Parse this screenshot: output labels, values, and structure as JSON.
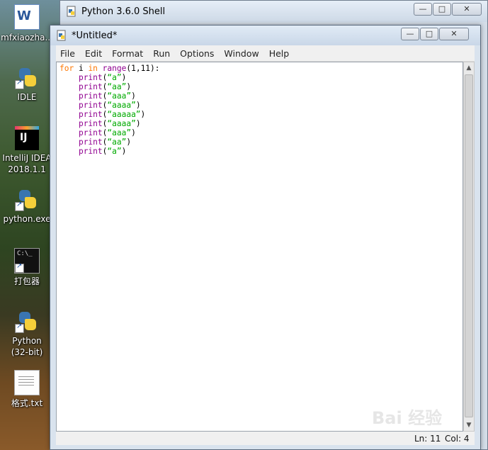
{
  "desktop": {
    "icons": [
      {
        "label": "mfxiaozha...",
        "icon": "word-document-icon"
      },
      {
        "label": "IDLE",
        "icon": "python-idle-icon"
      },
      {
        "label": "IntelliJ IDEA\n2018.1.1",
        "icon": "intellij-idea-icon"
      },
      {
        "label": "python.exe",
        "icon": "python-exe-icon"
      },
      {
        "label": "打包器",
        "icon": "command-prompt-icon"
      },
      {
        "label": "Python\n(32-bit)",
        "icon": "python-32bit-icon"
      },
      {
        "label": "格式.txt",
        "icon": "text-file-icon"
      }
    ]
  },
  "shell_window": {
    "title": "Python 3.6.0 Shell",
    "minimize": "—",
    "maximize": "□",
    "close": "✕"
  },
  "editor_window": {
    "title": "*Untitled*",
    "minimize": "—",
    "maximize": "□",
    "close": "✕",
    "menu": [
      "File",
      "Edit",
      "Format",
      "Run",
      "Options",
      "Window",
      "Help"
    ],
    "code": {
      "line1": {
        "kw1": "for",
        "var": " i ",
        "kw2": "in",
        "sp": " ",
        "func": "range",
        "args": "(1,11):"
      },
      "lines": [
        {
          "indent": "    ",
          "func": "print",
          "open": "(",
          "str": "“a”",
          "close": ")"
        },
        {
          "indent": "    ",
          "func": "print",
          "open": "(",
          "str": "“aa”",
          "close": ")"
        },
        {
          "indent": "    ",
          "func": "print",
          "open": "(",
          "str": "“aaa”",
          "close": ")"
        },
        {
          "indent": "    ",
          "func": "print",
          "open": "(",
          "str": "“aaaa”",
          "close": ")"
        },
        {
          "indent": "    ",
          "func": "print",
          "open": "(",
          "str": "“aaaaa”",
          "close": ")"
        },
        {
          "indent": "    ",
          "func": "print",
          "open": "(",
          "str": "“aaaa”",
          "close": ")"
        },
        {
          "indent": "    ",
          "func": "print",
          "open": "(",
          "str": "“aaa”",
          "close": ")"
        },
        {
          "indent": "    ",
          "func": "print",
          "open": "(",
          "str": "“aa”",
          "close": ")"
        },
        {
          "indent": "    ",
          "func": "print",
          "open": "(",
          "str": "“a”",
          "close": ")"
        }
      ]
    },
    "status": {
      "line": "Ln: 11",
      "col": "Col: 4"
    }
  },
  "watermark": "Bai 经验",
  "colors": {
    "keyword": "#ff7700",
    "builtin": "#900090",
    "string": "#00aa00"
  }
}
